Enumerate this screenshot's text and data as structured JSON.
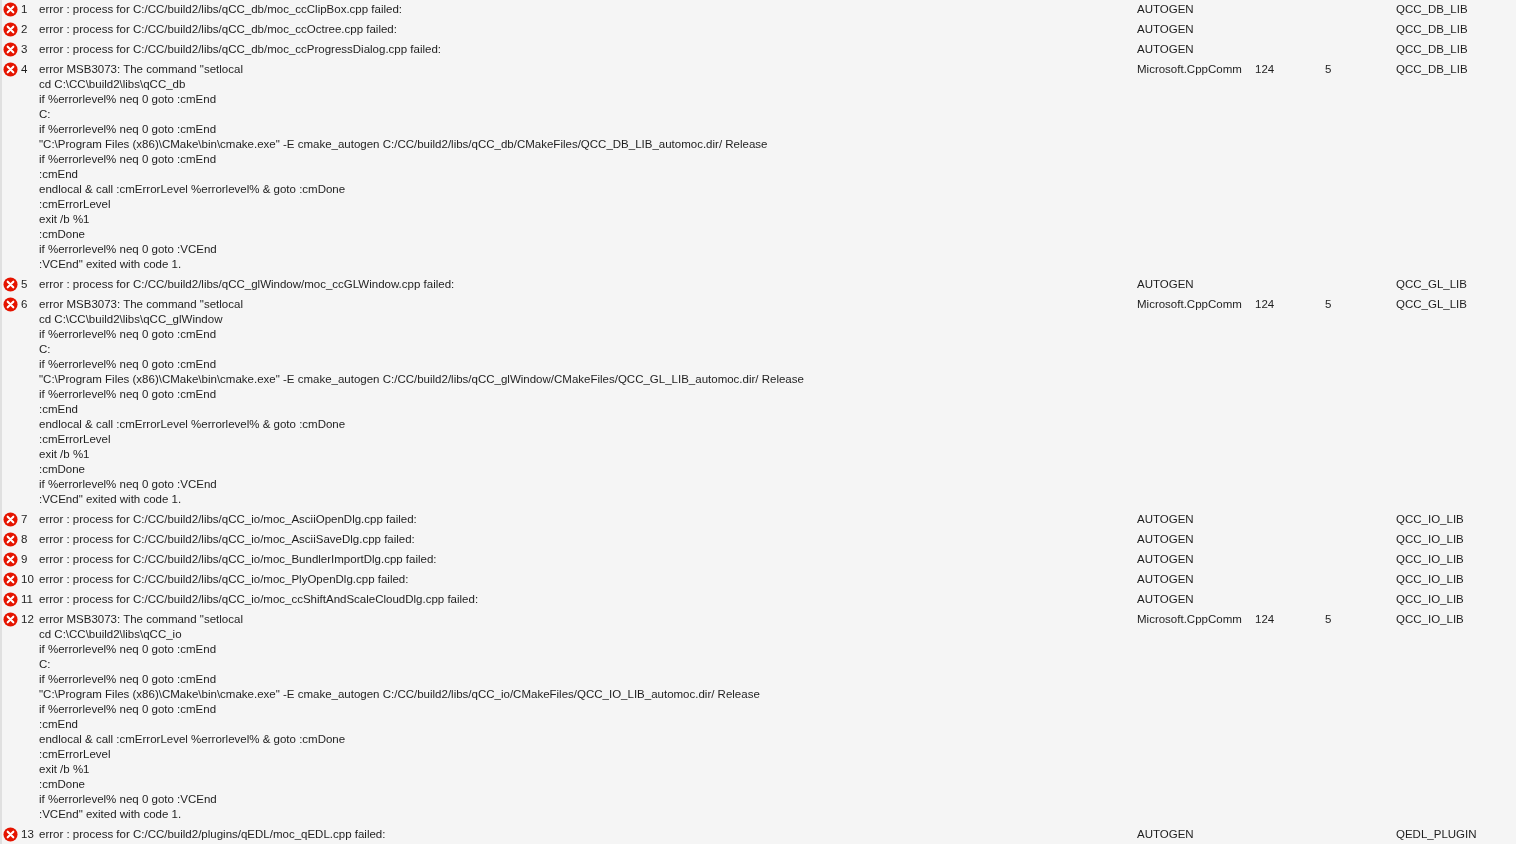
{
  "rows": [
    {
      "number": "1",
      "description": "error : process for C:/CC/build2/libs/qCC_db/moc_ccClipBox.cpp failed:",
      "file": "AUTOGEN",
      "project": "QCC_DB_LIB"
    },
    {
      "number": "2",
      "description": "error : process for C:/CC/build2/libs/qCC_db/moc_ccOctree.cpp failed:",
      "file": "AUTOGEN",
      "project": "QCC_DB_LIB"
    },
    {
      "number": "3",
      "description": "error : process for C:/CC/build2/libs/qCC_db/moc_ccProgressDialog.cpp failed:",
      "file": "AUTOGEN",
      "project": "QCC_DB_LIB"
    },
    {
      "number": "4",
      "description": "error MSB3073: The command \"setlocal\ncd C:\\CC\\build2\\libs\\qCC_db\nif %errorlevel% neq 0 goto :cmEnd\nC:\nif %errorlevel% neq 0 goto :cmEnd\n\"C:\\Program Files (x86)\\CMake\\bin\\cmake.exe\" -E cmake_autogen C:/CC/build2/libs/qCC_db/CMakeFiles/QCC_DB_LIB_automoc.dir/ Release\nif %errorlevel% neq 0 goto :cmEnd\n:cmEnd\nendlocal & call :cmErrorLevel %errorlevel% & goto :cmDone\n:cmErrorLevel\nexit /b %1\n:cmDone\nif %errorlevel% neq 0 goto :VCEnd\n:VCEnd\" exited with code 1.",
      "file": "Microsoft.CppComm",
      "line": "124",
      "column": "5",
      "project": "QCC_DB_LIB"
    },
    {
      "number": "5",
      "description": "error : process for C:/CC/build2/libs/qCC_glWindow/moc_ccGLWindow.cpp failed:",
      "file": "AUTOGEN",
      "project": "QCC_GL_LIB"
    },
    {
      "number": "6",
      "description": "error MSB3073: The command \"setlocal\ncd C:\\CC\\build2\\libs\\qCC_glWindow\nif %errorlevel% neq 0 goto :cmEnd\nC:\nif %errorlevel% neq 0 goto :cmEnd\n\"C:\\Program Files (x86)\\CMake\\bin\\cmake.exe\" -E cmake_autogen C:/CC/build2/libs/qCC_glWindow/CMakeFiles/QCC_GL_LIB_automoc.dir/ Release\nif %errorlevel% neq 0 goto :cmEnd\n:cmEnd\nendlocal & call :cmErrorLevel %errorlevel% & goto :cmDone\n:cmErrorLevel\nexit /b %1\n:cmDone\nif %errorlevel% neq 0 goto :VCEnd\n:VCEnd\" exited with code 1.",
      "file": "Microsoft.CppComm",
      "line": "124",
      "column": "5",
      "project": "QCC_GL_LIB"
    },
    {
      "number": "7",
      "description": "error : process for C:/CC/build2/libs/qCC_io/moc_AsciiOpenDlg.cpp failed:",
      "file": "AUTOGEN",
      "project": "QCC_IO_LIB"
    },
    {
      "number": "8",
      "description": "error : process for C:/CC/build2/libs/qCC_io/moc_AsciiSaveDlg.cpp failed:",
      "file": "AUTOGEN",
      "project": "QCC_IO_LIB"
    },
    {
      "number": "9",
      "description": "error : process for C:/CC/build2/libs/qCC_io/moc_BundlerImportDlg.cpp failed:",
      "file": "AUTOGEN",
      "project": "QCC_IO_LIB"
    },
    {
      "number": "10",
      "description": "error : process for C:/CC/build2/libs/qCC_io/moc_PlyOpenDlg.cpp failed:",
      "file": "AUTOGEN",
      "project": "QCC_IO_LIB"
    },
    {
      "number": "11",
      "description": "error : process for C:/CC/build2/libs/qCC_io/moc_ccShiftAndScaleCloudDlg.cpp failed:",
      "file": "AUTOGEN",
      "project": "QCC_IO_LIB"
    },
    {
      "number": "12",
      "description": "error MSB3073: The command \"setlocal\ncd C:\\CC\\build2\\libs\\qCC_io\nif %errorlevel% neq 0 goto :cmEnd\nC:\nif %errorlevel% neq 0 goto :cmEnd\n\"C:\\Program Files (x86)\\CMake\\bin\\cmake.exe\" -E cmake_autogen C:/CC/build2/libs/qCC_io/CMakeFiles/QCC_IO_LIB_automoc.dir/ Release\nif %errorlevel% neq 0 goto :cmEnd\n:cmEnd\nendlocal & call :cmErrorLevel %errorlevel% & goto :cmDone\n:cmErrorLevel\nexit /b %1\n:cmDone\nif %errorlevel% neq 0 goto :VCEnd\n:VCEnd\" exited with code 1.",
      "file": "Microsoft.CppComm",
      "line": "124",
      "column": "5",
      "project": "QCC_IO_LIB"
    },
    {
      "number": "13",
      "description": "error : process for C:/CC/build2/plugins/qEDL/moc_qEDL.cpp failed:",
      "file": "AUTOGEN",
      "project": "QEDL_PLUGIN"
    }
  ]
}
